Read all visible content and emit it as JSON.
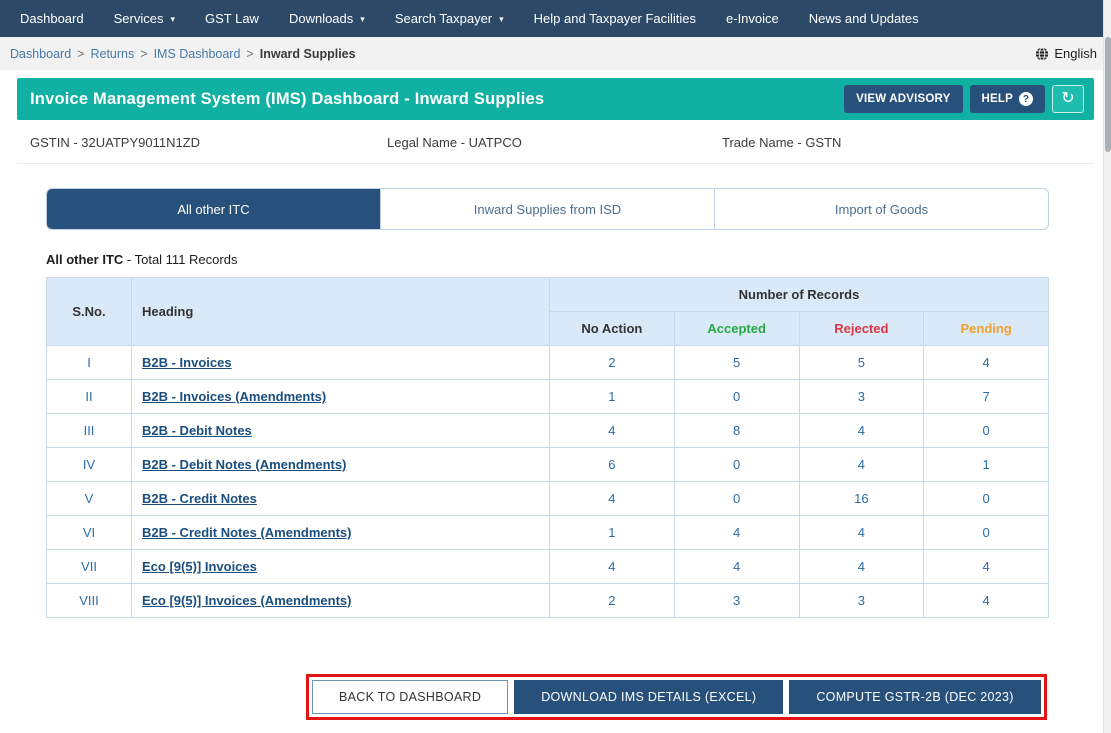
{
  "topnav": {
    "items": [
      {
        "label": "Dashboard",
        "caret": false
      },
      {
        "label": "Services",
        "caret": true
      },
      {
        "label": "GST Law",
        "caret": false
      },
      {
        "label": "Downloads",
        "caret": true
      },
      {
        "label": "Search Taxpayer",
        "caret": true
      },
      {
        "label": "Help and Taxpayer Facilities",
        "caret": false
      },
      {
        "label": "e-Invoice",
        "caret": false
      },
      {
        "label": "News and Updates",
        "caret": false
      }
    ]
  },
  "breadcrumb": {
    "links": [
      "Dashboard",
      "Returns",
      "IMS Dashboard"
    ],
    "current": "Inward Supplies",
    "separator": ">",
    "language": "English"
  },
  "header": {
    "title": "Invoice Management System (IMS) Dashboard - Inward Supplies",
    "view_advisory_label": "VIEW ADVISORY",
    "help_label": "HELP",
    "help_badge": "?",
    "refresh_glyph": "↻"
  },
  "taxpayer": {
    "gstin": "GSTIN - 32UATPY9011N1ZD",
    "legal_name": "Legal Name - UATPCO",
    "trade_name": "Trade Name - GSTN"
  },
  "tabs": [
    {
      "label": "All other ITC",
      "active": true
    },
    {
      "label": "Inward Supplies from ISD",
      "active": false
    },
    {
      "label": "Import of Goods",
      "active": false
    }
  ],
  "section": {
    "title_bold": "All other ITC",
    "title_rest": " - Total 111 Records"
  },
  "table": {
    "col_sno": "S.No.",
    "col_heading": "Heading",
    "col_group": "Number of Records",
    "subcols": [
      {
        "label": "No Action",
        "color": "#333333"
      },
      {
        "label": "Accepted",
        "color": "#28a745"
      },
      {
        "label": "Rejected",
        "color": "#dc3545"
      },
      {
        "label": "Pending",
        "color": "#f0a12f"
      }
    ],
    "rows": [
      {
        "sno": "I",
        "heading": "B2B - Invoices",
        "counts": [
          "2",
          "5",
          "5",
          "4"
        ]
      },
      {
        "sno": "II",
        "heading": "B2B - Invoices (Amendments)",
        "counts": [
          "1",
          "0",
          "3",
          "7"
        ]
      },
      {
        "sno": "III",
        "heading": "B2B - Debit Notes",
        "counts": [
          "4",
          "8",
          "4",
          "0"
        ]
      },
      {
        "sno": "IV",
        "heading": "B2B - Debit Notes (Amendments)",
        "counts": [
          "6",
          "0",
          "4",
          "1"
        ]
      },
      {
        "sno": "V",
        "heading": "B2B - Credit Notes",
        "counts": [
          "4",
          "0",
          "16",
          "0"
        ]
      },
      {
        "sno": "VI",
        "heading": "B2B - Credit Notes (Amendments)",
        "counts": [
          "1",
          "4",
          "4",
          "0"
        ]
      },
      {
        "sno": "VII",
        "heading": "Eco [9(5)] Invoices",
        "counts": [
          "4",
          "4",
          "4",
          "4"
        ]
      },
      {
        "sno": "VIII",
        "heading": "Eco [9(5)] Invoices (Amendments)",
        "counts": [
          "2",
          "3",
          "3",
          "4"
        ]
      }
    ]
  },
  "footer_buttons": [
    {
      "label": "BACK TO DASHBOARD",
      "variant": "outline",
      "name": "back-to-dashboard-button"
    },
    {
      "label": "DOWNLOAD IMS DETAILS (EXCEL)",
      "variant": "solid",
      "name": "download-ims-details-button"
    },
    {
      "label": "COMPUTE GSTR-2B (DEC 2023)",
      "variant": "solid",
      "name": "compute-gstr2b-button"
    }
  ],
  "colors": {
    "navbar": "#2c4a68",
    "teal_header": "#10b0a2",
    "primary_button": "#27507b",
    "accepted": "#28a745",
    "rejected": "#dc3545",
    "pending": "#f0a12f",
    "annotation": "#e51414",
    "table_header_bg": "#d9e9f7"
  }
}
